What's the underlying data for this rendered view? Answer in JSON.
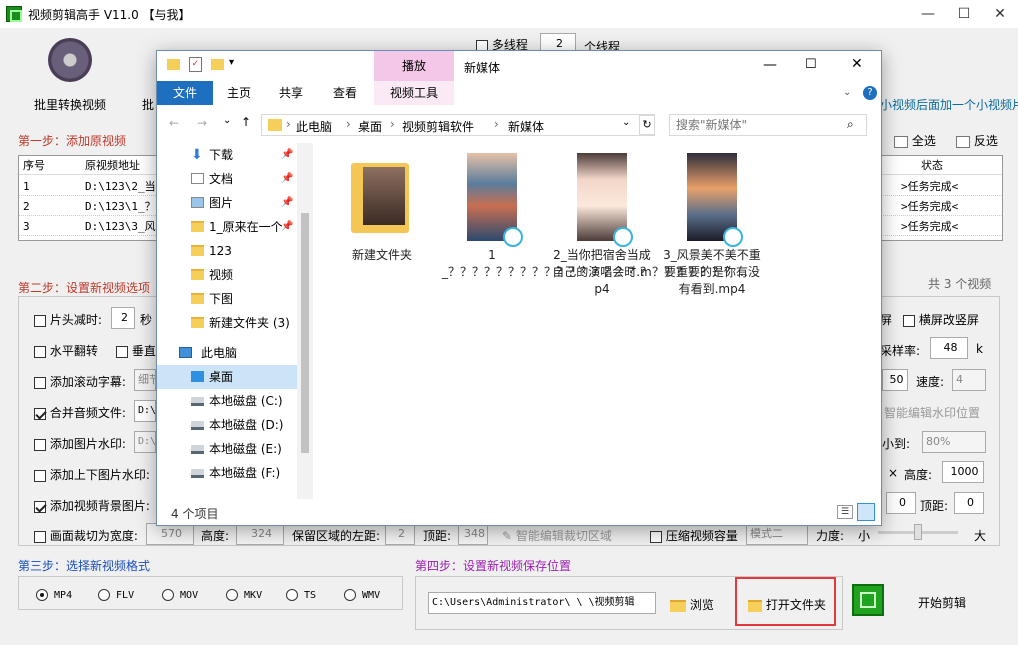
{
  "window": {
    "title": "视频剪辑高手 V11.0  【与我】",
    "min": "—",
    "max": "☐",
    "close": "✕"
  },
  "toolbar": {
    "batch_convert": "批里转换视频",
    "batch2": "批",
    "multithread_label": "多线程",
    "thread_count": "2",
    "thread_unit": "个线程",
    "tail_hint": "小视频后面加一个小视频片"
  },
  "step1": {
    "title": "第一步：添加原视频",
    "select_all": "全选",
    "invert": "反选",
    "columns": {
      "no": "序号",
      "path": "原视频地址",
      "status": "状态"
    },
    "rows": [
      {
        "no": "1",
        "path": "D:\\123\\2_当你",
        "status": ">任务完成<"
      },
      {
        "no": "2",
        "path": "D:\\123\\1_？？",
        "status": ">任务完成<"
      },
      {
        "no": "3",
        "path": "D:\\123\\3_风景",
        "status": ">任务完成<"
      }
    ],
    "count": "共 3 个视频"
  },
  "step2": {
    "title": "第二步：设置新视频选项",
    "trim_head": "片头减时:",
    "trim_head_val": "2",
    "sec": "秒",
    "hflip": "水平翻转",
    "vflip": "垂直",
    "scroll_sub": "添加滚动字幕:",
    "scroll_sub_val": "细节",
    "merge_audio": "合并音频文件:",
    "merge_audio_val": "D:\\",
    "img_watermark": "添加图片水印:",
    "img_watermark_val": "D:\\",
    "topbottom_wm": "添加上下图片水印:",
    "bg_image": "添加视频背景图片:",
    "crop_width": "画面裁切为宽度:",
    "crop_width_val": "570",
    "height": "高度:",
    "height_val": "324",
    "keep_left": "保留区域的左距:",
    "keep_left_val": "2",
    "top_margin": "顶距:",
    "top_margin_val": "348",
    "smart_crop": "智能编辑裁切区域",
    "compress": "压缩视频容量",
    "compress_mode": "模式二",
    "strength": "力度:",
    "small": "小",
    "large": "大",
    "landscape": "横屏改竖屏",
    "screen_suffix": "屏",
    "sample_rate": "采样率:",
    "sample_rate_val": "48",
    "k": "k",
    "speed_box": "50",
    "speed": "速度:",
    "speed_val": "4",
    "smart_wm": "智能编辑水印位置",
    "shrink": "小到:",
    "shrink_val": "80%",
    "x": "×",
    "height2": "高度:",
    "height2_val": "1000",
    "left_val": "0",
    "top2": "顶距:",
    "top2_val": "0"
  },
  "step3": {
    "title": "第三步：选择新视频格式",
    "formats": [
      "MP4",
      "FLV",
      "MOV",
      "MKV",
      "TS",
      "WMV"
    ],
    "selected": "MP4"
  },
  "step4": {
    "title": "第四步：设置新视频保存位置",
    "path": "C:\\Users\\Administrator\\  \\  \\视频剪辑",
    "browse": "浏览",
    "open_folder": "打开文件夹",
    "start": "开始剪辑"
  },
  "explorer": {
    "ctx_tab": "播放",
    "title": "新媒体",
    "tabs": [
      "文件",
      "主页",
      "共享",
      "查看",
      "视频工具"
    ],
    "breadcrumb": [
      "此电脑",
      "桌面",
      "视频剪辑软件",
      "新媒体"
    ],
    "search_placeholder": "搜索\"新媒体\"",
    "nav": [
      {
        "label": "下载",
        "icon": "download-icon",
        "pin": true
      },
      {
        "label": "文档",
        "icon": "document-icon",
        "pin": true
      },
      {
        "label": "图片",
        "icon": "picture-icon",
        "pin": true
      },
      {
        "label": "1_原来在一个",
        "icon": "folder-icon",
        "pin": true
      },
      {
        "label": "123",
        "icon": "folder-icon"
      },
      {
        "label": "视频",
        "icon": "folder-icon"
      },
      {
        "label": "下图",
        "icon": "folder-icon"
      },
      {
        "label": "新建文件夹 (3)",
        "icon": "folder-icon"
      },
      {
        "label": "此电脑",
        "icon": "computer-icon"
      },
      {
        "label": "桌面",
        "icon": "desktop-icon",
        "selected": true
      },
      {
        "label": "本地磁盘 (C:)",
        "icon": "drive-icon"
      },
      {
        "label": "本地磁盘 (D:)",
        "icon": "drive-icon"
      },
      {
        "label": "本地磁盘 (E:)",
        "icon": "drive-icon"
      },
      {
        "label": "本地磁盘 (F:)",
        "icon": "drive-icon"
      }
    ],
    "files": [
      {
        "name": "新建文件夹",
        "type": "folder"
      },
      {
        "name": "1_？？？？？？？？？？？？？？？？？？？？？？？？…",
        "type": "video"
      },
      {
        "name": "2_当你把宿舍当成自己的演唱会时.mp4",
        "type": "video"
      },
      {
        "name": "3_风景美不美不重要重要的是你有没有看到.mp4",
        "type": "video"
      }
    ],
    "status": "4 个项目"
  }
}
